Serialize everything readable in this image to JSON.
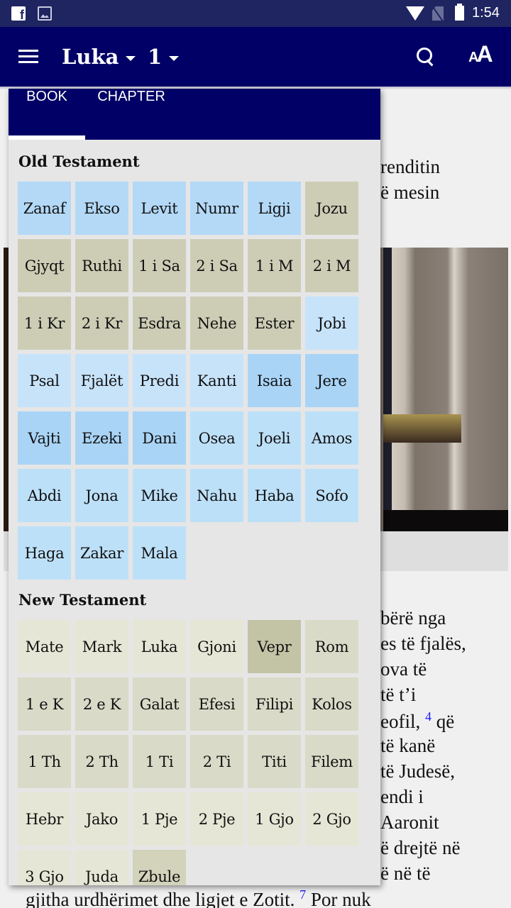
{
  "status_bar": {
    "icons": [
      "facebook-icon",
      "image-icon",
      "wifi-icon",
      "no-signal-icon",
      "battery-icon"
    ],
    "time": "1:54"
  },
  "app_bar": {
    "menu_icon": "hamburger-icon",
    "book": "Luka",
    "chapter": "1",
    "search_icon": "search-icon",
    "font_size_icon": "font-size-icon",
    "font_size_small": "A",
    "font_size_big": "A",
    "background_color": "#000066"
  },
  "background": {
    "lines_top": [
      "renditin",
      "ë mesin"
    ],
    "lines_bottom": [
      "bërë nga",
      "es të fjalës,",
      "ova të",
      " të t’i",
      "eofil,",
      "4",
      "që",
      "të kanë",
      "të Judesë,",
      "endi i",
      "Aaronit",
      "ë drejtë në",
      "ë në të",
      "gjitha urdhërimet dhe ligjet e Zotit.",
      "7",
      "Por nuk"
    ]
  },
  "selector": {
    "tabs": [
      {
        "label": "BOOK",
        "active": true
      },
      {
        "label": "CHAPTER",
        "active": false
      }
    ],
    "old_testament": {
      "title": "Old Testament",
      "books": [
        {
          "label": "Zanaf",
          "color": "#b3d9f7"
        },
        {
          "label": "Ekso",
          "color": "#b3d9f7"
        },
        {
          "label": "Levit",
          "color": "#b3d9f7"
        },
        {
          "label": "Numr",
          "color": "#b3d9f7"
        },
        {
          "label": "Ligji",
          "color": "#b3d9f7"
        },
        {
          "label": "Jozu",
          "color": "#cdcdb6"
        },
        {
          "label": "Gjyqt",
          "color": "#cdcdb6"
        },
        {
          "label": "Ruthi",
          "color": "#cdcdb6"
        },
        {
          "label": "1 i Sa",
          "color": "#cdcdb6"
        },
        {
          "label": "2 i Sa",
          "color": "#cdcdb6"
        },
        {
          "label": "1 i M",
          "color": "#cdcdb6"
        },
        {
          "label": "2 i M",
          "color": "#cdcdb6"
        },
        {
          "label": "1 i Kr",
          "color": "#cdcdb6"
        },
        {
          "label": "2 i Kr",
          "color": "#cdcdb6"
        },
        {
          "label": "Esdra",
          "color": "#cdcdb6"
        },
        {
          "label": "Nehe",
          "color": "#cdcdb6"
        },
        {
          "label": "Ester",
          "color": "#cdcdb6"
        },
        {
          "label": "Jobi",
          "color": "#c7e3fa"
        },
        {
          "label": "Psal",
          "color": "#c7e3fa"
        },
        {
          "label": "Fjalët",
          "color": "#c7e3fa"
        },
        {
          "label": "Predi",
          "color": "#c7e3fa"
        },
        {
          "label": "Kanti",
          "color": "#c7e3fa"
        },
        {
          "label": "Isaia",
          "color": "#a9d4f6"
        },
        {
          "label": "Jere",
          "color": "#a9d4f6"
        },
        {
          "label": "Vajti",
          "color": "#a9d4f6"
        },
        {
          "label": "Ezeki",
          "color": "#a9d4f6"
        },
        {
          "label": "Dani",
          "color": "#a9d4f6"
        },
        {
          "label": "Osea",
          "color": "#bde0f9"
        },
        {
          "label": "Joeli",
          "color": "#bde0f9"
        },
        {
          "label": "Amos",
          "color": "#bde0f9"
        },
        {
          "label": "Abdi",
          "color": "#bde0f9"
        },
        {
          "label": "Jona",
          "color": "#bde0f9"
        },
        {
          "label": "Mike",
          "color": "#bde0f9"
        },
        {
          "label": "Nahu",
          "color": "#bde0f9"
        },
        {
          "label": "Haba",
          "color": "#bde0f9"
        },
        {
          "label": "Sofo",
          "color": "#bde0f9"
        },
        {
          "label": "Haga",
          "color": "#bde0f9"
        },
        {
          "label": "Zakar",
          "color": "#bde0f9"
        },
        {
          "label": "Mala",
          "color": "#bde0f9"
        }
      ]
    },
    "new_testament": {
      "title": "New Testament",
      "books": [
        {
          "label": "Mate",
          "color": "#e6e6d6"
        },
        {
          "label": "Mark",
          "color": "#e6e6d6"
        },
        {
          "label": "Luka",
          "color": "#e6e6d6"
        },
        {
          "label": "Gjoni",
          "color": "#e6e6d6"
        },
        {
          "label": "Vepr",
          "color": "#c3c3a6"
        },
        {
          "label": "Rom",
          "color": "#dadac8"
        },
        {
          "label": "1 e K",
          "color": "#dadac8"
        },
        {
          "label": "2 e K",
          "color": "#dadac8"
        },
        {
          "label": "Galat",
          "color": "#dadac8"
        },
        {
          "label": "Efesi",
          "color": "#dadac8"
        },
        {
          "label": "Filipi",
          "color": "#dadac8"
        },
        {
          "label": "Kolos",
          "color": "#dadac8"
        },
        {
          "label": "1 Th",
          "color": "#dadac8"
        },
        {
          "label": "2 Th",
          "color": "#dadac8"
        },
        {
          "label": "1 Ti",
          "color": "#dadac8"
        },
        {
          "label": "2 Ti",
          "color": "#dadac8"
        },
        {
          "label": "Titi",
          "color": "#dadac8"
        },
        {
          "label": "Filem",
          "color": "#dadac8"
        },
        {
          "label": "Hebr",
          "color": "#e6e6d6"
        },
        {
          "label": "Jako",
          "color": "#e6e6d6"
        },
        {
          "label": "1 Pje",
          "color": "#e6e6d6"
        },
        {
          "label": "2 Pje",
          "color": "#e6e6d6"
        },
        {
          "label": "1 Gjo",
          "color": "#e6e6d6"
        },
        {
          "label": "2 Gjo",
          "color": "#e6e6d6"
        },
        {
          "label": "3 Gjo",
          "color": "#e6e6d6"
        },
        {
          "label": "Juda",
          "color": "#e6e6d6"
        },
        {
          "label": "Zbule",
          "color": "#d3d3bc"
        }
      ]
    }
  }
}
